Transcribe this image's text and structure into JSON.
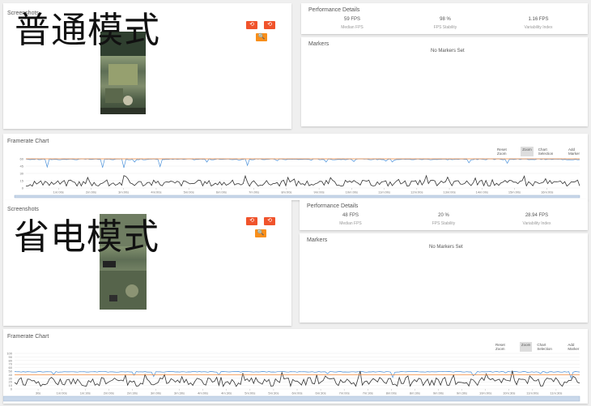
{
  "sessions": [
    {
      "mode_label": "普通模式",
      "screenshots_title": "Screenshots",
      "performance_title": "Performance Details",
      "stats": [
        {
          "value": "59 FPS",
          "label": "Median FPS"
        },
        {
          "value": "98 %",
          "label": "FPS Stability"
        },
        {
          "value": "1.16 FPS",
          "label": "Variability Index"
        }
      ],
      "markers_title": "Markers",
      "markers_empty": "No Markers Set",
      "chart_title": "Framerate Chart",
      "toolbar": [
        "Reset Zoom",
        "Zoom",
        "Chart Selection",
        "Add Marker"
      ],
      "toolbar_active": "Zoom",
      "buttons": {
        "reset1": "⟲",
        "reset2": "⟲",
        "zoom": "🔍"
      }
    },
    {
      "mode_label": "省电模式",
      "screenshots_title": "Screenshots",
      "performance_title": "Performance Details",
      "stats": [
        {
          "value": "48 FPS",
          "label": "Median FPS"
        },
        {
          "value": "20 %",
          "label": "FPS Stability"
        },
        {
          "value": "28.94 FPS",
          "label": "Variability Index"
        }
      ],
      "markers_title": "Markers",
      "markers_empty": "No Markers Set",
      "chart_title": "Framerate Chart",
      "toolbar": [
        "Reset Zoom",
        "Zoom",
        "Chart Selection",
        "Add Marker"
      ],
      "toolbar_active": "Zoom",
      "buttons": {
        "reset1": "⟲",
        "reset2": "⟲",
        "zoom": "🔍"
      }
    }
  ],
  "chart_data": [
    {
      "type": "line",
      "title": "Framerate Chart",
      "y_ticks": [
        0,
        15,
        30,
        45,
        60
      ],
      "ylim": [
        0,
        60
      ],
      "x_ticks": [
        "1m:00s",
        "2m:00s",
        "3m:00s",
        "4m:00s",
        "5m:00s",
        "6m:00s",
        "7m:00s",
        "8m:00s",
        "9m:00s",
        "10m:00s",
        "11m:00s",
        "12m:00s",
        "13m:00s",
        "14m:00s",
        "15m:00s",
        "16m:00s"
      ],
      "series": [
        {
          "role": "fps",
          "color": "#4a90d9",
          "approx_value": 59
        },
        {
          "role": "frametime",
          "color": "#333333",
          "approx_value": 10
        },
        {
          "role": "reference",
          "color": "#f58b3c",
          "approx_value": 60
        }
      ]
    },
    {
      "type": "line",
      "title": "Framerate Chart",
      "y_ticks": [
        0,
        10,
        20,
        30,
        40,
        50,
        60,
        70,
        80,
        90,
        100
      ],
      "ylim": [
        0,
        100
      ],
      "x_ticks": [
        "30s",
        "1m:00s",
        "1m:30s",
        "2m:00s",
        "2m:30s",
        "3m:00s",
        "3m:30s",
        "4m:00s",
        "4m:30s",
        "5m:00s",
        "5m:30s",
        "6m:00s",
        "6m:30s",
        "7m:00s",
        "7m:30s",
        "8m:00s",
        "8m:30s",
        "9m:00s",
        "9m:30s",
        "10m:00s",
        "10m:30s",
        "11m:00s",
        "11m:30s"
      ],
      "series": [
        {
          "role": "fps",
          "color": "#4a90d9",
          "approx_value": 48
        },
        {
          "role": "frametime",
          "color": "#333333",
          "approx_value": 20
        },
        {
          "role": "reference",
          "color": "#f58b3c",
          "approx_value": 40
        }
      ]
    }
  ]
}
